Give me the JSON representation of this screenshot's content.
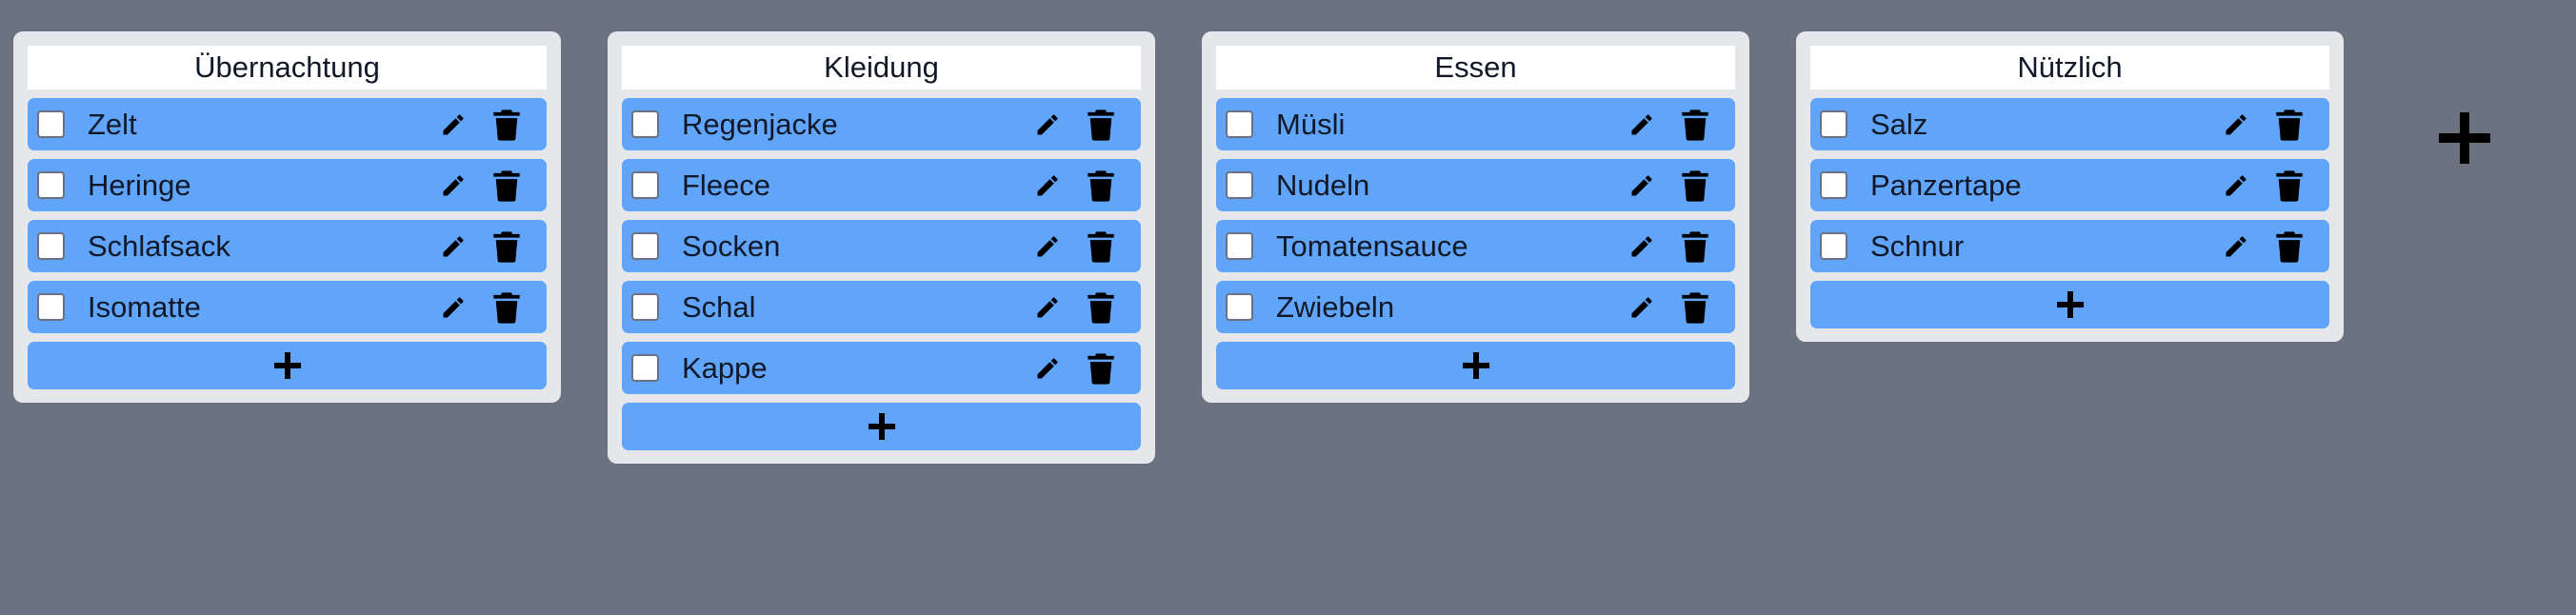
{
  "colors": {
    "background": "#6b7280",
    "column": "#e5e7eb",
    "item": "#60a5fa",
    "title_bg": "#ffffff"
  },
  "columns": [
    {
      "title": "Übernachtung",
      "items": [
        {
          "label": "Zelt",
          "checked": false
        },
        {
          "label": "Heringe",
          "checked": false
        },
        {
          "label": "Schlafsack",
          "checked": false
        },
        {
          "label": "Isomatte",
          "checked": false
        }
      ]
    },
    {
      "title": "Kleidung",
      "items": [
        {
          "label": "Regenjacke",
          "checked": false
        },
        {
          "label": "Fleece",
          "checked": false
        },
        {
          "label": "Socken",
          "checked": false
        },
        {
          "label": "Schal",
          "checked": false
        },
        {
          "label": "Kappe",
          "checked": false
        }
      ]
    },
    {
      "title": "Essen",
      "items": [
        {
          "label": "Müsli",
          "checked": false
        },
        {
          "label": "Nudeln",
          "checked": false
        },
        {
          "label": "Tomatensauce",
          "checked": false
        },
        {
          "label": "Zwiebeln",
          "checked": false
        }
      ]
    },
    {
      "title": "Nützlich",
      "items": [
        {
          "label": "Salz",
          "checked": false
        },
        {
          "label": "Panzertape",
          "checked": false
        },
        {
          "label": "Schnur",
          "checked": false
        }
      ]
    }
  ],
  "icons": {
    "edit": "pencil-icon",
    "delete": "trash-icon",
    "add": "plus-icon"
  }
}
